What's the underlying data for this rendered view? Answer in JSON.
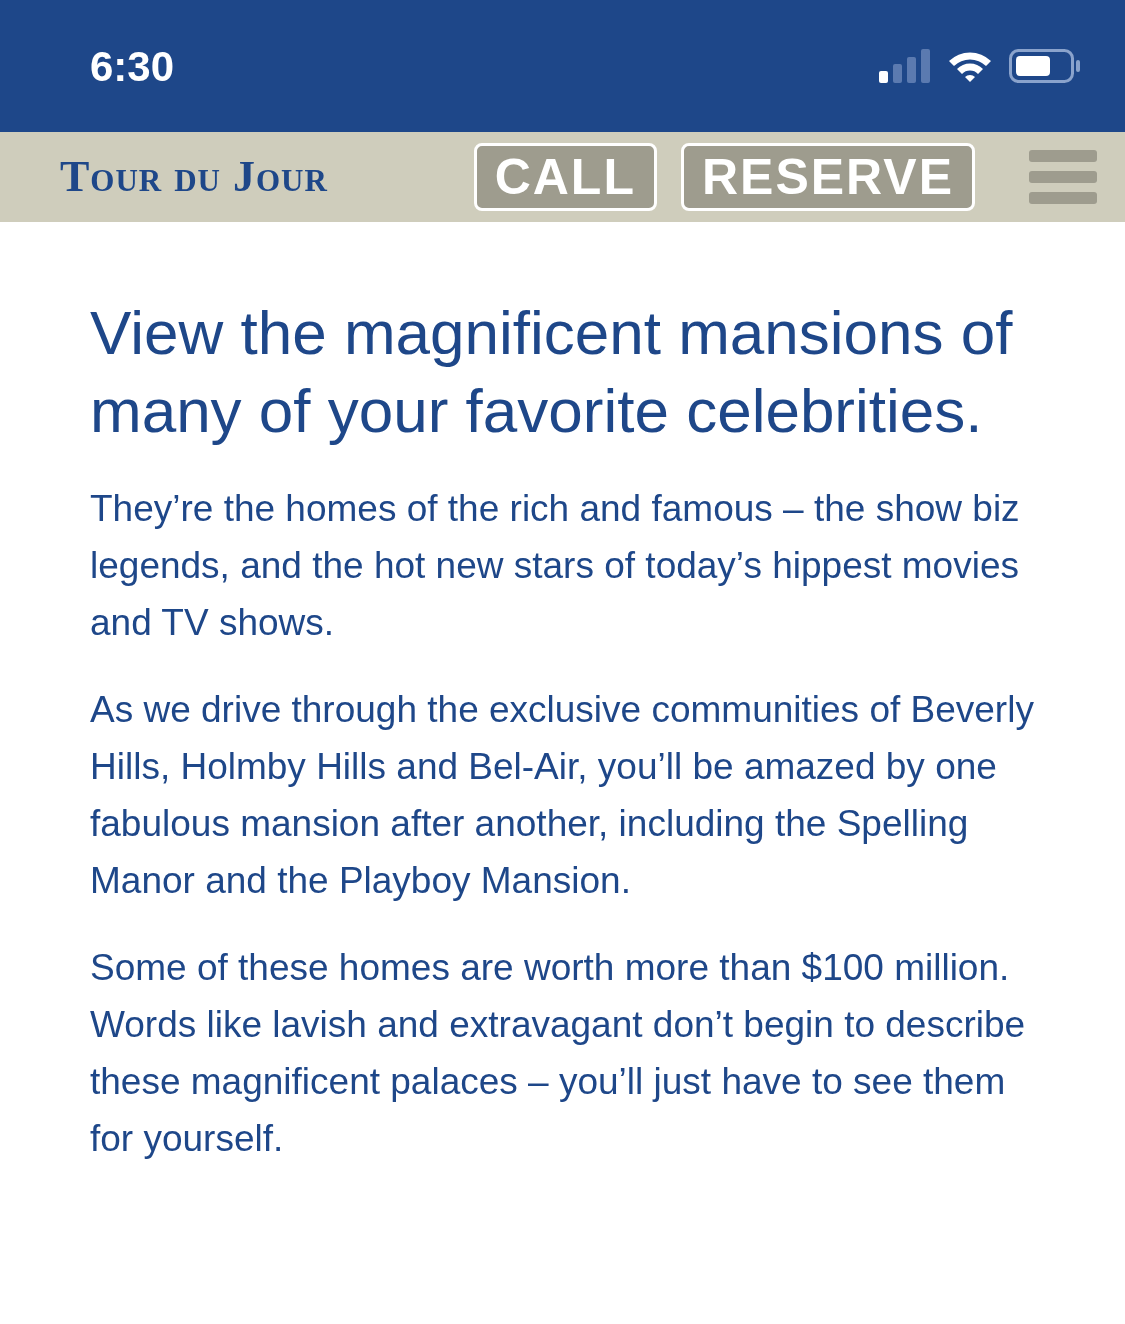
{
  "status_bar": {
    "time": "6:30"
  },
  "nav": {
    "logo": "Tour du Jour",
    "buttons": [
      "CALL",
      "RESERVE"
    ]
  },
  "heading": "View the magnificent mansions of many of your favorite celebrities.",
  "paragraphs": [
    "They’re the homes of the rich and famous – the show biz legends, and the hot new stars of today’s hippest movies and TV shows.",
    "As we drive through the exclusive communities of Beverly Hills, Holmby Hills and Bel-Air, you’ll be amazed by one fabulous mansion after another, including the Spelling Manor and the Playboy Mansion.",
    "Some of these homes are worth more than $100 million. Words like lavish and extravagant don’t begin to describe these magnificent palaces – you’ll just have to see them for yourself."
  ]
}
